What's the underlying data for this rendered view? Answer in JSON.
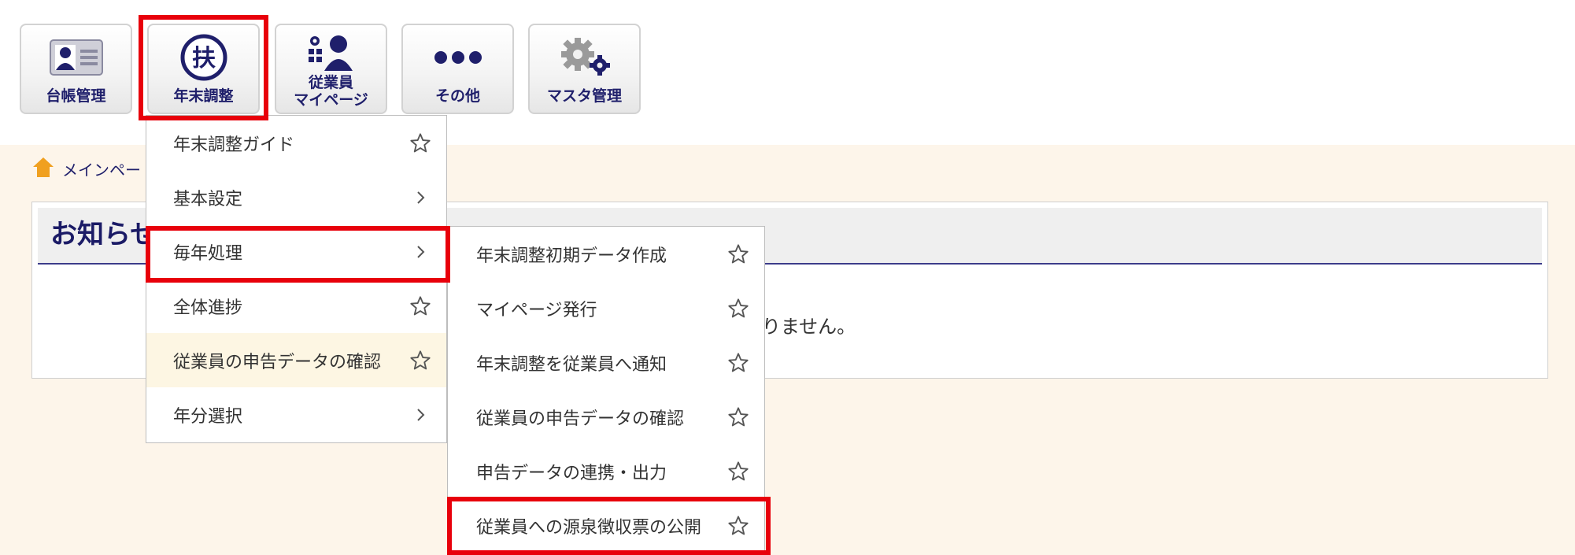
{
  "nav": {
    "ledger": {
      "label": "台帳管理",
      "icon": "id-card-icon"
    },
    "year_end": {
      "label": "年末調整",
      "icon": "fu-kanji-circle-icon",
      "icon_text": "扶"
    },
    "employee_mypage": {
      "label": "従業員\nマイページ",
      "icon": "employee-group-icon"
    },
    "other": {
      "label": "その他",
      "icon": "more-dots-icon"
    },
    "master": {
      "label": "マスタ管理",
      "icon": "gears-icon"
    }
  },
  "breadcrumb": {
    "label": "メインペー",
    "icon": "home-icon"
  },
  "notice": {
    "title": "お知らせ",
    "empty_message": "はありません。"
  },
  "menu": {
    "items": [
      {
        "label": "年末調整ガイド",
        "icon": "star-icon"
      },
      {
        "label": "基本設定",
        "icon": "chevron-right-icon"
      },
      {
        "label": "毎年処理",
        "icon": "chevron-right-icon"
      },
      {
        "label": "全体進捗",
        "icon": "star-icon"
      },
      {
        "label": "従業員の申告データの確認",
        "icon": "star-icon"
      },
      {
        "label": "年分選択",
        "icon": "chevron-right-icon"
      }
    ]
  },
  "submenu": {
    "items": [
      {
        "label": "年末調整初期データ作成",
        "icon": "star-icon"
      },
      {
        "label": "マイページ発行",
        "icon": "star-icon"
      },
      {
        "label": "年末調整を従業員へ通知",
        "icon": "star-icon"
      },
      {
        "label": "従業員の申告データの確認",
        "icon": "star-icon"
      },
      {
        "label": "申告データの連携・出力",
        "icon": "star-icon"
      },
      {
        "label": "従業員への源泉徴収票の公開",
        "icon": "star-icon"
      }
    ]
  },
  "colors": {
    "highlight": "#e8000b",
    "nav_text": "#1f1f6b",
    "content_bg": "#fdf5ea",
    "hover_bg": "#fdf6e3"
  }
}
